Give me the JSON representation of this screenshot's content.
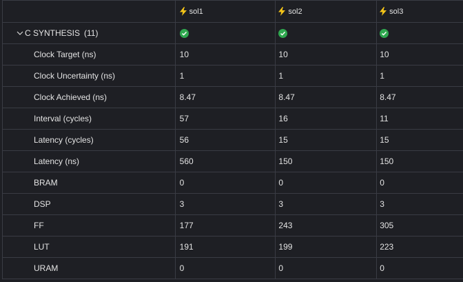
{
  "colors": {
    "background": "#1e1f24",
    "grid": "#3a3c44",
    "status_ok": "#2fa84f",
    "bolt": "#f5c518"
  },
  "columns": [
    "sol1",
    "sol2",
    "sol3"
  ],
  "section": {
    "label": "C SYNTHESIS",
    "count": "(11)",
    "status_icon": "check-circle-icon"
  },
  "rows": [
    {
      "label": "Clock Target (ns)",
      "values": [
        "10",
        "10",
        "10"
      ]
    },
    {
      "label": "Clock Uncertainty (ns)",
      "values": [
        "1",
        "1",
        "1"
      ]
    },
    {
      "label": "Clock Achieved (ns)",
      "values": [
        "8.47",
        "8.47",
        "8.47"
      ]
    },
    {
      "label": "Interval (cycles)",
      "values": [
        "57",
        "16",
        "11"
      ]
    },
    {
      "label": "Latency (cycles)",
      "values": [
        "56",
        "15",
        "15"
      ]
    },
    {
      "label": "Latency (ns)",
      "values": [
        "560",
        "150",
        "150"
      ]
    },
    {
      "label": "BRAM",
      "values": [
        "0",
        "0",
        "0"
      ]
    },
    {
      "label": "DSP",
      "values": [
        "3",
        "3",
        "3"
      ]
    },
    {
      "label": "FF",
      "values": [
        "177",
        "243",
        "305"
      ]
    },
    {
      "label": "LUT",
      "values": [
        "191",
        "199",
        "223"
      ]
    },
    {
      "label": "URAM",
      "values": [
        "0",
        "0",
        "0"
      ]
    }
  ]
}
